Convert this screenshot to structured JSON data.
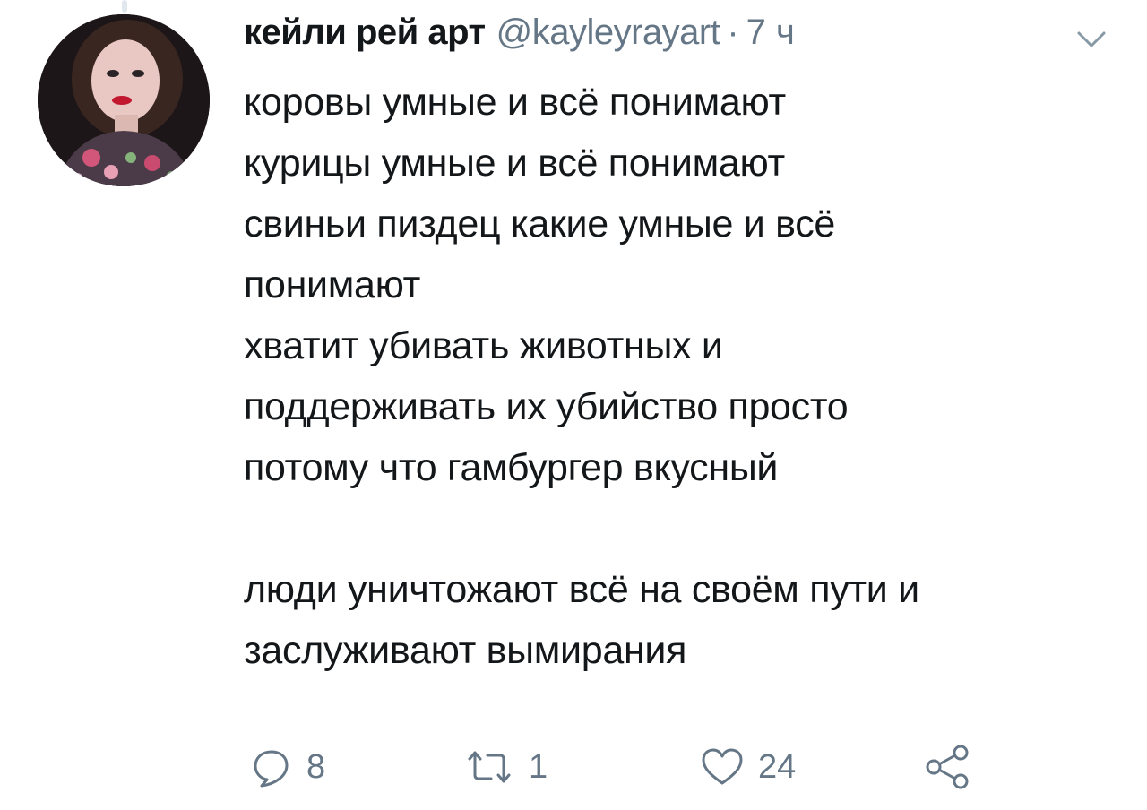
{
  "tweet": {
    "author": {
      "display_name": "кейли рей арт",
      "handle": "@kayleyrayart"
    },
    "separator": "·",
    "timestamp": "7 ч",
    "lines": [
      "коровы умные и всё понимают",
      "курицы умные и всё понимают",
      "свиньи пиздец какие умные и всё",
      "понимают",
      "хватит убивать животных и",
      "поддерживать их убийство просто",
      "потому что гамбургер вкусный",
      "",
      "люди уничтожают всё на своём пути и",
      "заслуживают вымирания"
    ],
    "actions": {
      "reply_count": "8",
      "retweet_count": "1",
      "like_count": "24"
    }
  },
  "icons": {
    "reply": "reply-icon",
    "retweet": "retweet-icon",
    "like": "heart-icon",
    "share": "share-icon",
    "caret": "chevron-down-icon"
  },
  "colors": {
    "text": "#14171a",
    "secondary": "#657786",
    "icon": "#657786",
    "thread_line": "#e1e8ed"
  }
}
